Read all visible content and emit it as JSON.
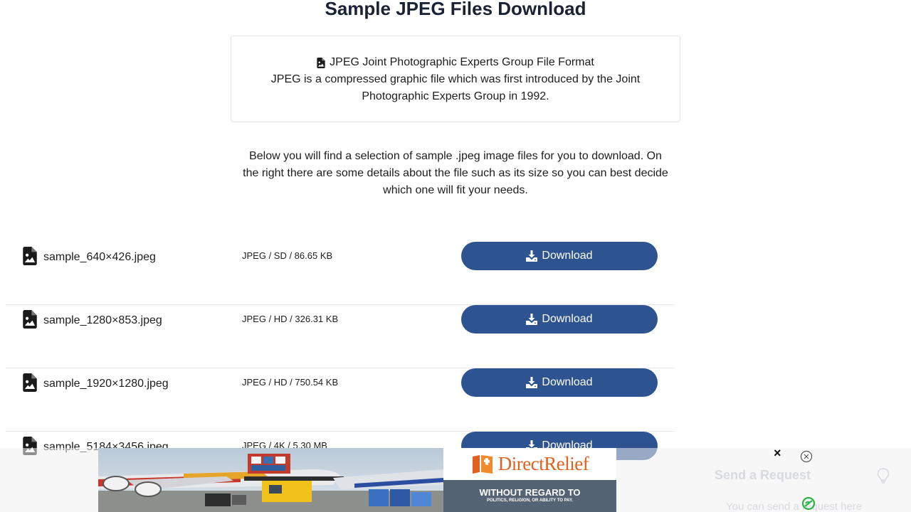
{
  "page": {
    "title": "Sample JPEG Files Download"
  },
  "info_card": {
    "heading": "JPEG Joint Photographic Experts Group File Format",
    "body": "JPEG is a compressed graphic file which was first introduced by the Joint Photographic Experts Group in 1992.",
    "icon": "file-image-icon"
  },
  "intro": {
    "text": "Below you will find a selection of sample .jpeg image files for you to download. On the right there are some details about the file such as its size so you can best decide which one will fit your needs."
  },
  "files": [
    {
      "name": "sample_640×426.jpeg",
      "meta": "JPEG / SD / 86.65 KB",
      "button": "Download"
    },
    {
      "name": "sample_1280×853.jpeg",
      "meta": "JPEG / HD / 326.31 KB",
      "button": "Download"
    },
    {
      "name": "sample_1920×1280.jpeg",
      "meta": "JPEG / HD / 750.54 KB",
      "button": "Download"
    },
    {
      "name": "sample_5184×3456.jpeg",
      "meta": "JPEG / 4K / 5.30 MB",
      "button": "Download"
    }
  ],
  "sidebar": {
    "title": "Send a Request",
    "text": "You can send a request here"
  },
  "ad": {
    "brand": "DirectRelief",
    "tagline": "WITHOUT REGARD TO",
    "tagline_sub": "POLITICS, RELIGION, OR ABILITY TO PAY.",
    "close_label": "×"
  },
  "colors": {
    "button_bg": "#2d5390",
    "ad_brand": "#e2611f",
    "ad_tag_bg": "#556474"
  }
}
